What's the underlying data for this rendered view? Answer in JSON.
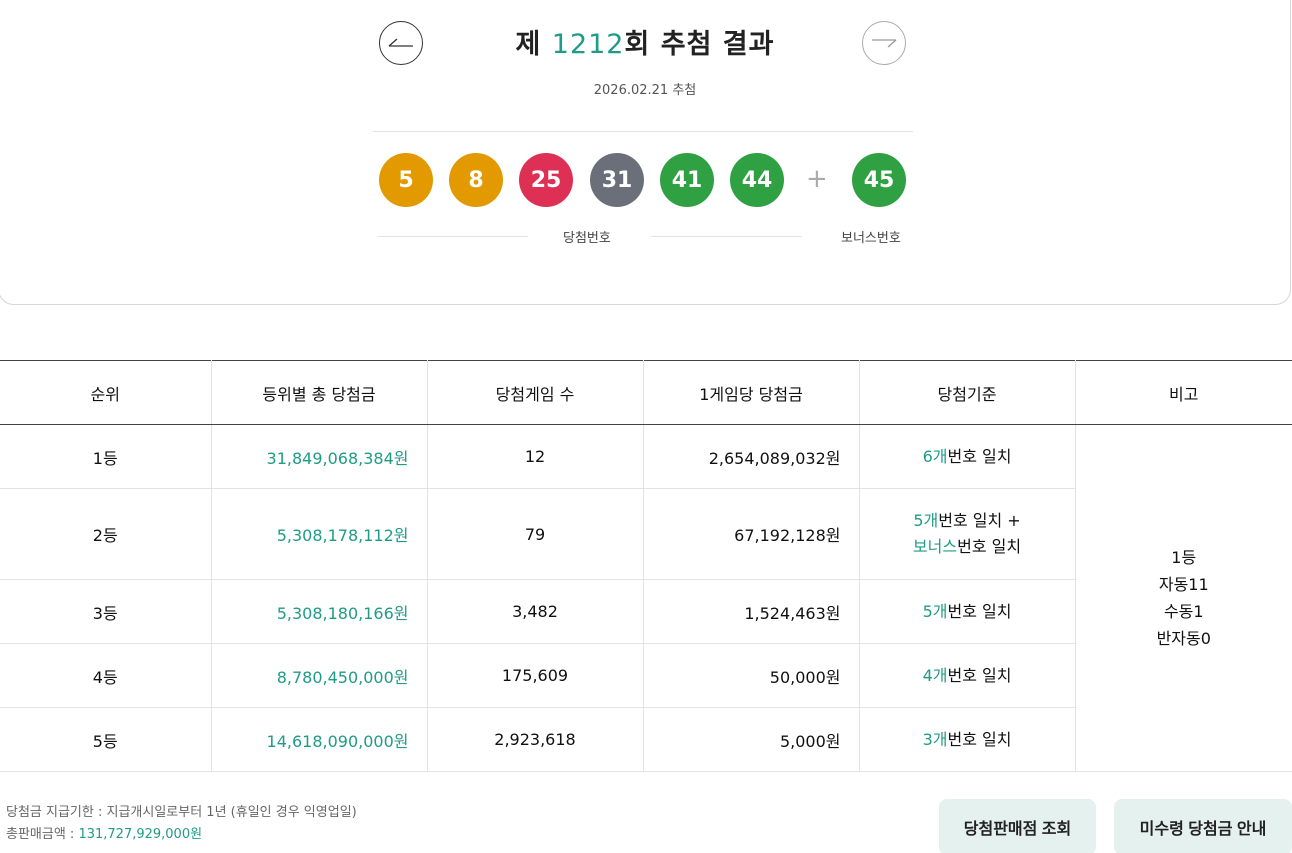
{
  "header": {
    "title_prefix": "제 ",
    "round": "1212",
    "title_suffix": "회 추첨 결과",
    "date": "2026.02.21 추첨",
    "prev_icon": "arrow-left-icon",
    "next_icon": "arrow-right-icon"
  },
  "balls": {
    "numbers": [
      {
        "value": "5",
        "color": "#e29a00"
      },
      {
        "value": "8",
        "color": "#e29a00"
      },
      {
        "value": "25",
        "color": "#dd3054"
      },
      {
        "value": "31",
        "color": "#6b6f7a"
      },
      {
        "value": "41",
        "color": "#2fa142"
      },
      {
        "value": "44",
        "color": "#2fa142"
      }
    ],
    "plus": "+",
    "bonus": {
      "value": "45",
      "color": "#2fa142"
    },
    "winning_label": "당첨번호",
    "bonus_label": "보너스번호"
  },
  "table": {
    "headers": [
      "순위",
      "등위별 총 당첨금",
      "당첨게임 수",
      "1게임당 당첨금",
      "당첨기준",
      "비고"
    ],
    "rows": [
      {
        "rank": "1등",
        "total": "31,849,068,384원",
        "winners": "12",
        "per_game": "2,654,089,032원",
        "crit": [
          {
            "hl": "6개",
            "text": "번호 일치"
          }
        ]
      },
      {
        "rank": "2등",
        "total": "5,308,178,112원",
        "winners": "79",
        "per_game": "67,192,128원",
        "crit": [
          {
            "hl": "5개",
            "text": "번호 일치 +"
          },
          {
            "hl": "보너스",
            "text": "번호 일치"
          }
        ]
      },
      {
        "rank": "3등",
        "total": "5,308,180,166원",
        "winners": "3,482",
        "per_game": "1,524,463원",
        "crit": [
          {
            "hl": "5개",
            "text": "번호 일치"
          }
        ]
      },
      {
        "rank": "4등",
        "total": "8,780,450,000원",
        "winners": "175,609",
        "per_game": "50,000원",
        "crit": [
          {
            "hl": "4개",
            "text": "번호 일치"
          }
        ]
      },
      {
        "rank": "5등",
        "total": "14,618,090,000원",
        "winners": "2,923,618",
        "per_game": "5,000원",
        "crit": [
          {
            "hl": "3개",
            "text": "번호 일치"
          }
        ]
      }
    ],
    "note": [
      "1등",
      "자동11",
      "수동1",
      "반자동0"
    ]
  },
  "footer": {
    "deadline": "당첨금 지급기한 : 지급개시일로부터 1년 (휴일인 경우 익영업일)",
    "sales_label": "총판매금액 : ",
    "sales_amount": "131,727,929,000원",
    "store_button": "당첨판매점 조회",
    "unclaimed_button": "미수령 당첨금 안내"
  },
  "colors": {
    "accent": "#1f9c86",
    "button_bg": "#e5f1ef"
  }
}
